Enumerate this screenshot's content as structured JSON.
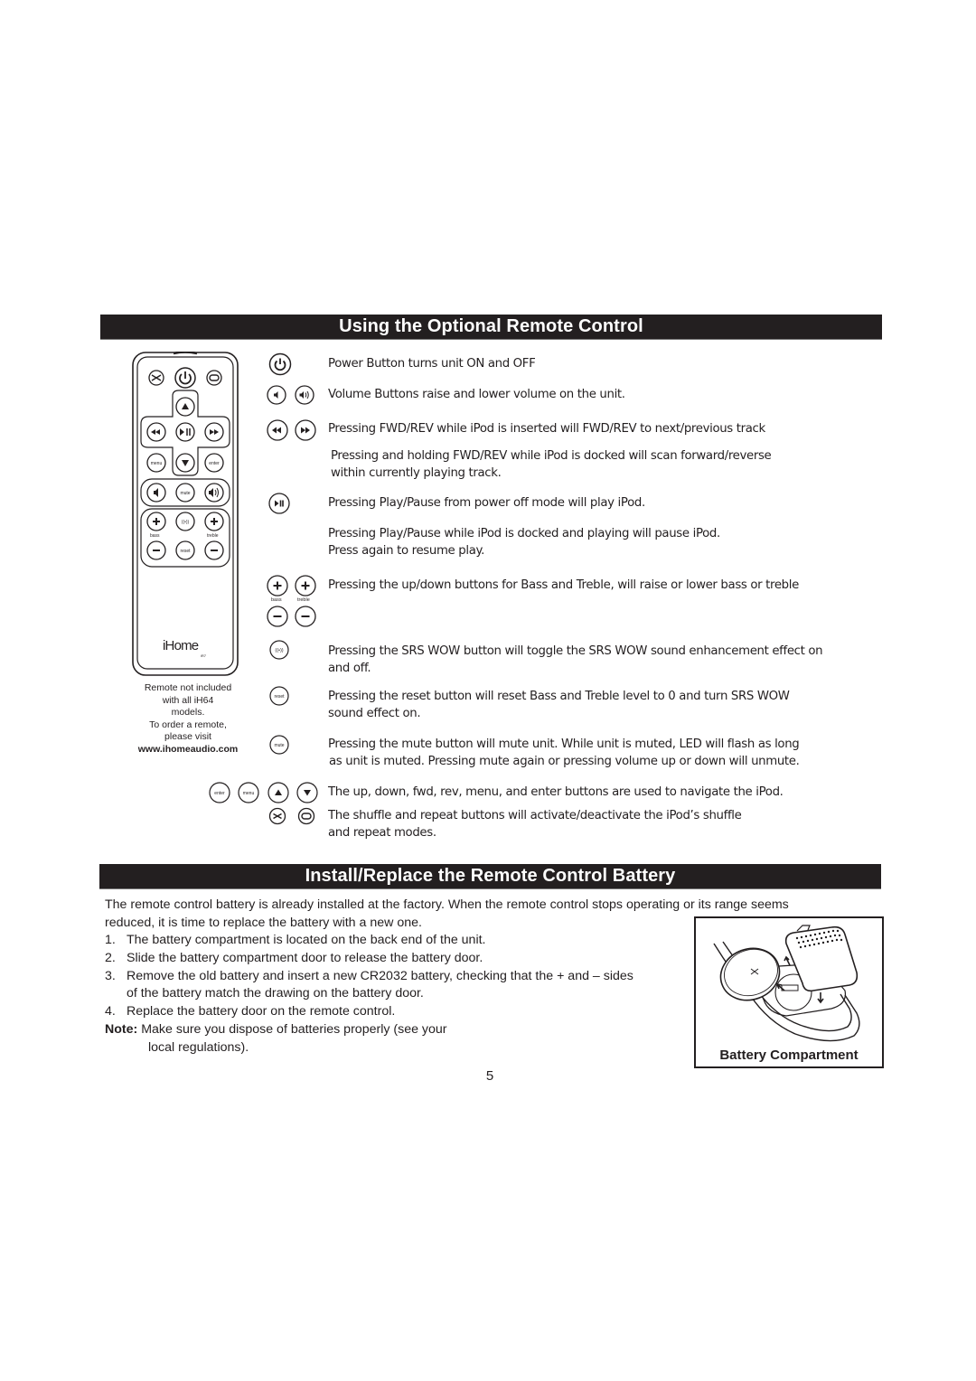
{
  "section1": {
    "title": "Using the Optional Remote Control",
    "remote": {
      "brand": "iHome",
      "model": "iR7",
      "labels": {
        "menu": "menu",
        "enter": "enter",
        "mute": "mute",
        "bass": "bass",
        "treble": "treble",
        "reset": "reset"
      },
      "note_lines": [
        "Remote not included",
        "with all iH64",
        "models.",
        "To order a remote,",
        "please visit"
      ],
      "note_url": "www.ihomeaudio.com"
    },
    "instructions": [
      {
        "icon": "power-icon",
        "lines": [
          "Power Button turns unit ON and OFF"
        ]
      },
      {
        "icon": "volume-icons",
        "lines": [
          "Volume Buttons raise and lower volume on the unit."
        ]
      },
      {
        "icon": "fwd-rev-icons",
        "lines": [
          "Pressing FWD/REV while iPod is inserted will FWD/REV to next/previous track"
        ]
      },
      {
        "icon": "none",
        "lines": [
          "Pressing and holding FWD/REV while iPod is  docked will scan forward/reverse",
          "within currently playing track."
        ]
      },
      {
        "icon": "play-pause-icon",
        "lines": [
          "Pressing Play/Pause from power off mode will play iPod."
        ]
      },
      {
        "icon": "none",
        "lines": [
          "Pressing Play/Pause while iPod is docked and playing will pause iPod.",
          "Press again to resume play."
        ]
      },
      {
        "icon": "bass-treble-icons",
        "lines": [
          "Pressing the up/down buttons for Bass and Treble, will raise or lower bass or treble"
        ]
      },
      {
        "icon": "srs-wow-icon",
        "lines": [
          "Pressing the SRS WOW button will toggle the SRS WOW sound enhancement effect on",
          "and off."
        ]
      },
      {
        "icon": "reset-icon",
        "lines": [
          "Pressing the reset button will reset Bass and Treble level to 0 and turn SRS WOW",
          "sound effect on."
        ]
      },
      {
        "icon": "mute-icon",
        "lines": [
          "Pressing the mute button will mute unit. While unit is muted, LED will flash as long",
          "as unit is muted. Pressing mute again or pressing volume up or down will unmute."
        ]
      },
      {
        "icon": "navigation-icons",
        "lines": [
          "The up, down, fwd, rev, menu, and enter buttons are used to navigate the iPod."
        ]
      },
      {
        "icon": "shuffle-repeat-icons",
        "lines": [
          "The shuffle and  repeat buttons will activate/deactivate the iPod’s shuffle",
          "and repeat modes."
        ]
      }
    ],
    "icon_labels": {
      "bass": "bass",
      "treble": "treble",
      "reset": "reset",
      "mute": "mute",
      "enter": "enter",
      "menu": "menu"
    }
  },
  "section2": {
    "title": "Install/Replace the Remote Control Battery",
    "intro_lines": [
      "The remote control battery is already installed at the factory. When the remote control stops operating or its range seems",
      "reduced, it is time to replace the battery with a new one."
    ],
    "steps": [
      {
        "num": "1.",
        "lines": [
          "The battery compartment is located on the back end of the unit."
        ]
      },
      {
        "num": "2.",
        "lines": [
          "Slide the battery compartment door to release the battery door."
        ]
      },
      {
        "num": "3.",
        "lines": [
          "Remove the old battery and insert a new CR2032 battery, checking that the + and – sides",
          "of the battery match the drawing on the battery door."
        ]
      },
      {
        "num": "4.",
        "lines": [
          "Replace the battery door on the remote control."
        ]
      }
    ],
    "note_label": "Note:",
    "note_lines": [
      "Make sure you dispose of batteries properly (see your",
      "local regulations)."
    ],
    "figure_caption": "Battery Compartment"
  },
  "page_number": "5"
}
